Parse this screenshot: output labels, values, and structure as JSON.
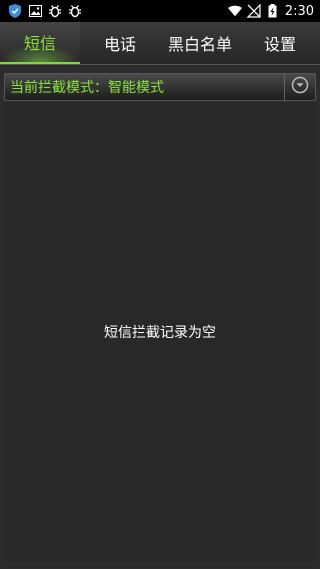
{
  "status_bar": {
    "time": "2:30",
    "left_icons": [
      "shield-icon",
      "image-icon",
      "bug-icon",
      "bug-icon"
    ],
    "right_icons": [
      "wifi-icon",
      "no-signal-icon",
      "battery-charging-icon"
    ]
  },
  "tabs": [
    {
      "label": "短信",
      "active": true
    },
    {
      "label": "电话",
      "active": false
    },
    {
      "label": "黑白名单",
      "active": false
    },
    {
      "label": "设置",
      "active": false
    }
  ],
  "mode": {
    "label": "当前拦截模式：智能模式",
    "dropdown_icon": "chevron-down-circle-icon"
  },
  "content": {
    "empty_message": "短信拦截记录为空"
  },
  "colors": {
    "accent": "#8be33a",
    "background": "#2c2c2c",
    "statusbar": "#000000"
  }
}
